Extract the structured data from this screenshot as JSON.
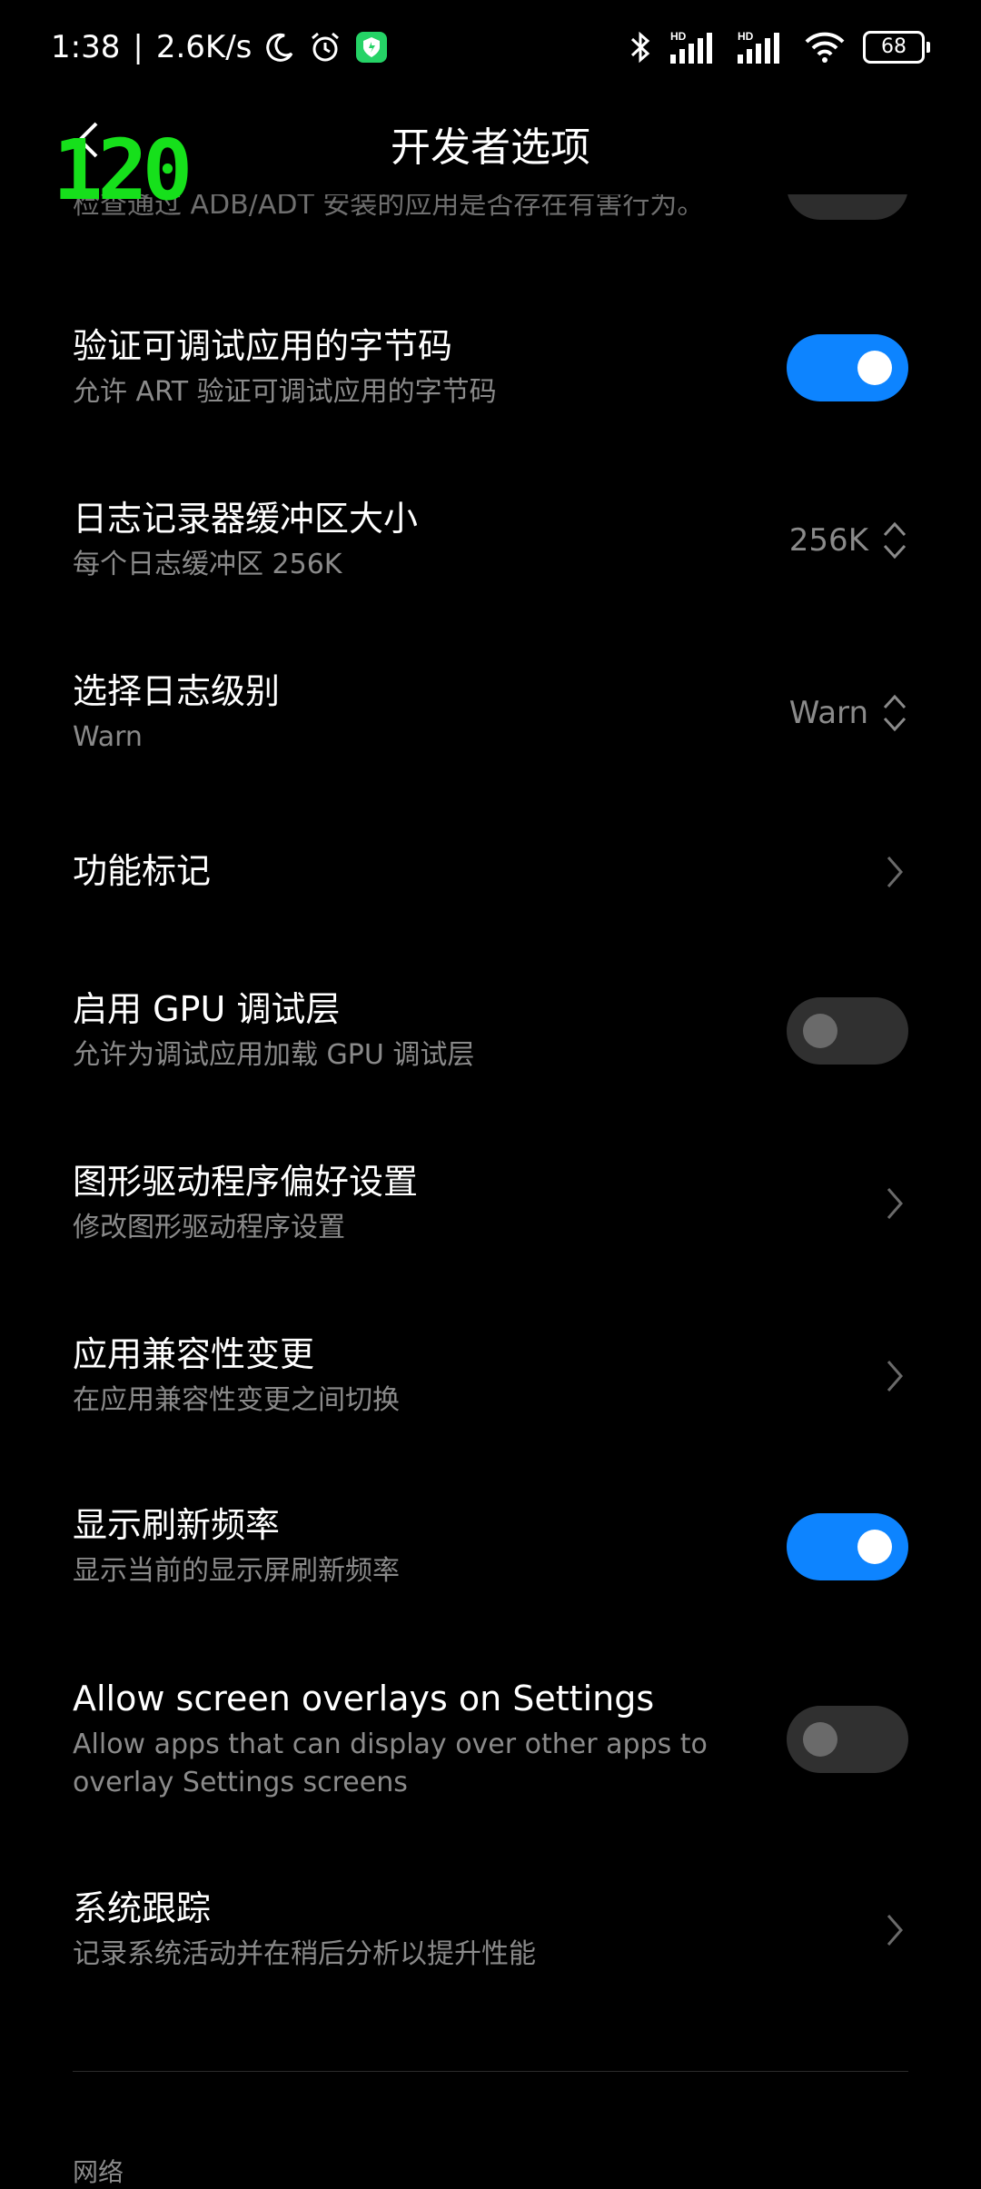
{
  "status_bar": {
    "time": "1:38",
    "separator": "|",
    "net_speed": "2.6K/s",
    "battery": "68",
    "hd1": "HD",
    "hd2": "HD"
  },
  "header": {
    "title": "开发者选项"
  },
  "fps_overlay": "120",
  "partial_row_text": "检查通过 ADB/ADT 安装的应用是否存在有害行为。",
  "settings": [
    {
      "title": "验证可调试应用的字节码",
      "subtitle": "允许 ART 验证可调试应用的字节码",
      "control": "toggle",
      "state": "on"
    },
    {
      "title": "日志记录器缓冲区大小",
      "subtitle": "每个日志缓冲区 256K",
      "control": "select",
      "value": "256K"
    },
    {
      "title": "选择日志级别",
      "subtitle": "Warn",
      "control": "select",
      "value": "Warn"
    },
    {
      "title": "功能标记",
      "subtitle": "",
      "control": "chevron"
    },
    {
      "title": "启用 GPU 调试层",
      "subtitle": "允许为调试应用加载 GPU 调试层",
      "control": "toggle",
      "state": "off"
    },
    {
      "title": "图形驱动程序偏好设置",
      "subtitle": "修改图形驱动程序设置",
      "control": "chevron"
    },
    {
      "title": "应用兼容性变更",
      "subtitle": "在应用兼容性变更之间切换",
      "control": "chevron"
    },
    {
      "title": "显示刷新频率",
      "subtitle": "显示当前的显示屏刷新频率",
      "control": "toggle",
      "state": "on"
    },
    {
      "title": "Allow screen overlays on Settings",
      "subtitle": "Allow apps that can display over other apps to overlay Settings screens",
      "control": "toggle",
      "state": "off"
    },
    {
      "title": "系统跟踪",
      "subtitle": "记录系统活动并在稍后分析以提升性能",
      "control": "chevron"
    }
  ],
  "section_label": "网络",
  "colors": {
    "accent": "#0d84ff",
    "fps": "#16e01b",
    "background": "#000000",
    "subtext": "#8a8a8a"
  }
}
